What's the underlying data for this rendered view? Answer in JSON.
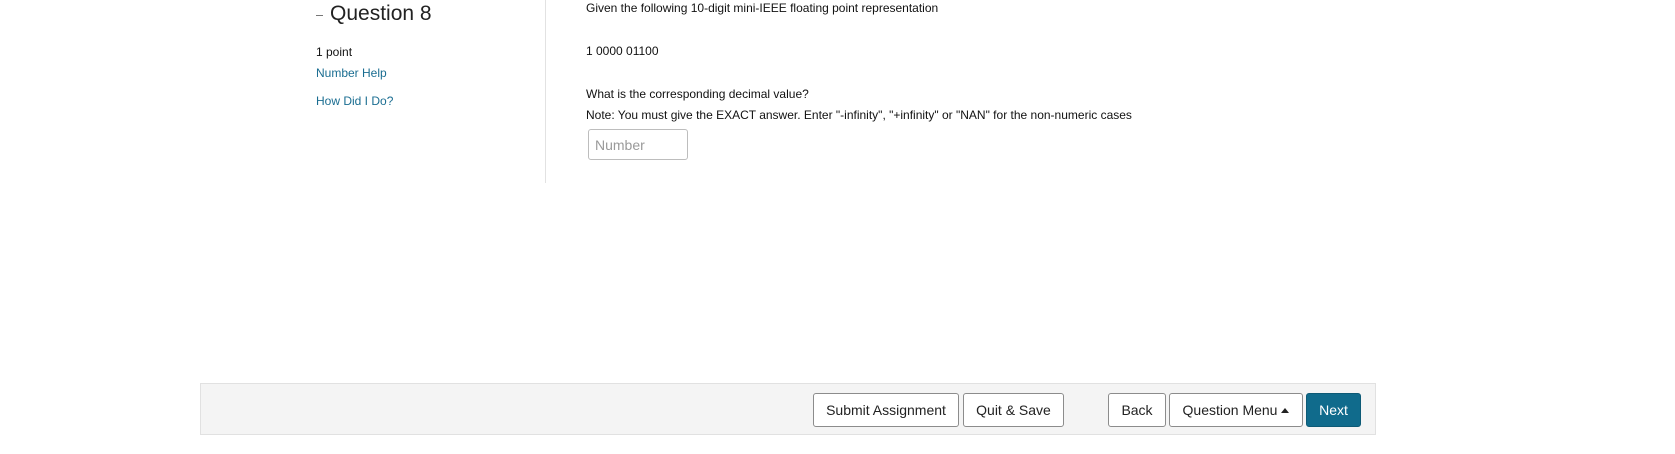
{
  "question": {
    "title": "Question 8",
    "points": "1 point",
    "links": {
      "number_help": "Number Help",
      "how_did_i_do": "How Did I Do?"
    }
  },
  "content": {
    "intro": "Given the following 10-digit mini-IEEE floating point representation",
    "bits": "1 0000 01100",
    "prompt": "What is the corresponding decimal value?",
    "note": "Note: You must give the EXACT answer. Enter \"-infinity\", \"+infinity\" or \"NAN\" for the non-numeric cases",
    "answer": {
      "value": "",
      "placeholder": "Number"
    }
  },
  "footer": {
    "submit_label": "Submit Assignment",
    "quit_label": "Quit & Save",
    "back_label": "Back",
    "menu_label": "Question Menu",
    "next_label": "Next"
  },
  "colors": {
    "link": "#1a6d91",
    "primary_button": "#106b8c",
    "footer_background": "#f4f4f4"
  },
  "icons": {
    "collapse": "minus-icon",
    "menu_caret": "caret-up-icon"
  }
}
